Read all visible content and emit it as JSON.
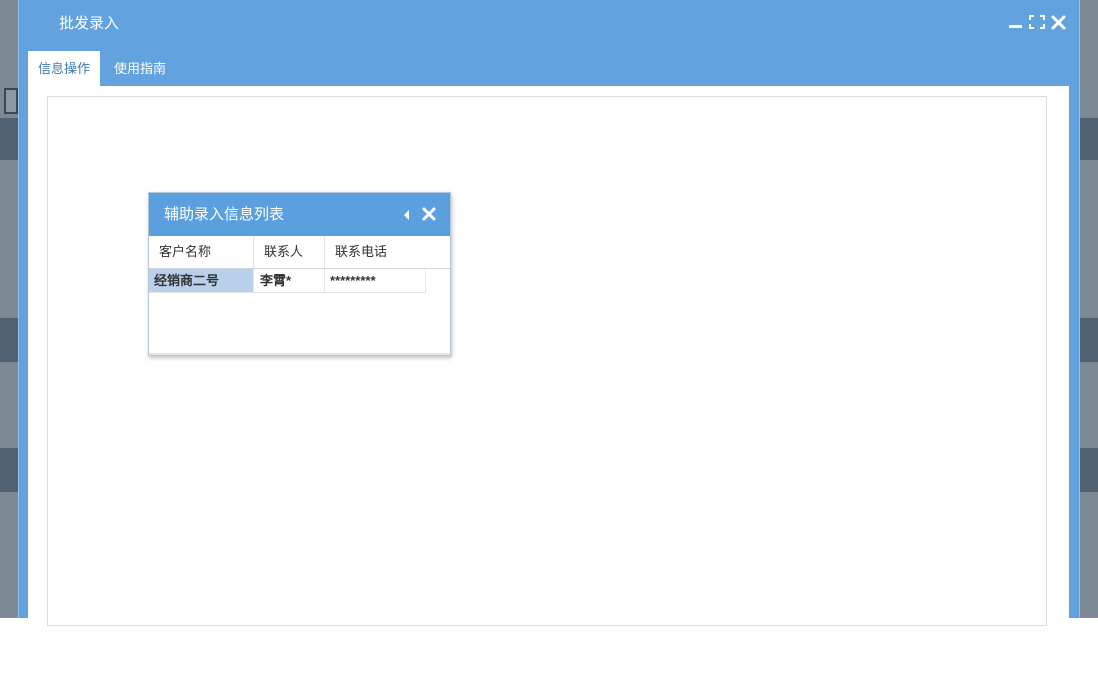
{
  "window": {
    "title": "批发录入"
  },
  "tabs": [
    {
      "label": "信息操作",
      "active": true
    },
    {
      "label": "使用指南",
      "active": false
    }
  ],
  "assist_panel": {
    "title": "辅助录入信息列表",
    "columns": [
      "客户名称",
      "联系人",
      "联系电话"
    ],
    "rows": [
      {
        "name": "经销商二号",
        "contact": "李霄*",
        "phone": "*********",
        "selected": true
      }
    ]
  },
  "colors": {
    "titlebar": "#62a2df",
    "panel_header": "#5aa0df",
    "active_tab_text": "#3f79b5",
    "selected_cell": "#b9d0ed"
  },
  "icons": {
    "minimize": "minimize-icon",
    "maximize": "maximize-icon",
    "close": "close-icon",
    "collapse": "caret-left-icon"
  }
}
